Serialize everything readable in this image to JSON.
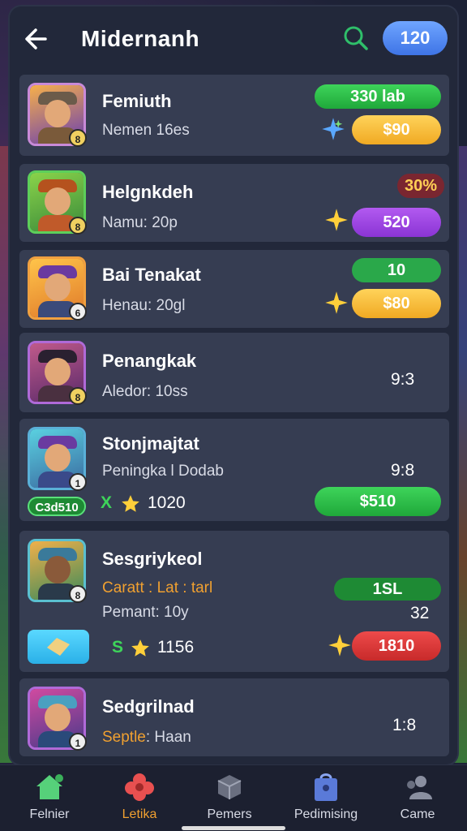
{
  "header": {
    "back_icon": "back-arrow-icon",
    "title": "Midernanh",
    "search_icon": "search-icon",
    "coins": "120"
  },
  "cards": [
    {
      "name": "Femiuth",
      "sub": "Nemen 16es",
      "level": "8",
      "badge": "330 lab",
      "price": "$90"
    },
    {
      "name": "Helgnkdeh",
      "sub": "Namu: 20p",
      "level": "8",
      "badge": "30%",
      "price": "520"
    },
    {
      "name": "Bai Tenakat",
      "sub": "Henau: 20gl",
      "level": "6",
      "badge": "10",
      "price": "$80"
    },
    {
      "name": "Penangkak",
      "sub": "Aledor: 10ss",
      "level": "8",
      "value": "9:3"
    },
    {
      "name": "Stonjmajtat",
      "sub": "Peningka l Dodab",
      "level": "1",
      "tag": "C3d510",
      "stat_prefix": "X",
      "stat": "1020",
      "value": "9:8",
      "price": "$510"
    },
    {
      "name": "Sesgriykeol",
      "sub_orange": "Caratt : Lat : tarl",
      "sub": "Pemant: 10y",
      "level": "8",
      "badge": "1SL",
      "count": "32",
      "stat_prefix": "S",
      "stat": "1156",
      "price": "1810"
    },
    {
      "name": "Sedgrilnad",
      "sub_orange": "Septle",
      "sub_rest": ": Haan",
      "level": "1",
      "value": "1:8"
    }
  ],
  "tabs": [
    {
      "label": "Felnier",
      "icon": "home-icon",
      "color": "#56d17a"
    },
    {
      "label": "Letika",
      "icon": "flower-icon",
      "color": "#e85050"
    },
    {
      "label": "Pemers",
      "icon": "cube-icon",
      "color": "#8a8fa0"
    },
    {
      "label": "Pedimising",
      "icon": "shopping-bag-icon",
      "color": "#5a7ad8"
    },
    {
      "label": "Came",
      "icon": "users-icon",
      "color": "#8a8fa0"
    }
  ]
}
